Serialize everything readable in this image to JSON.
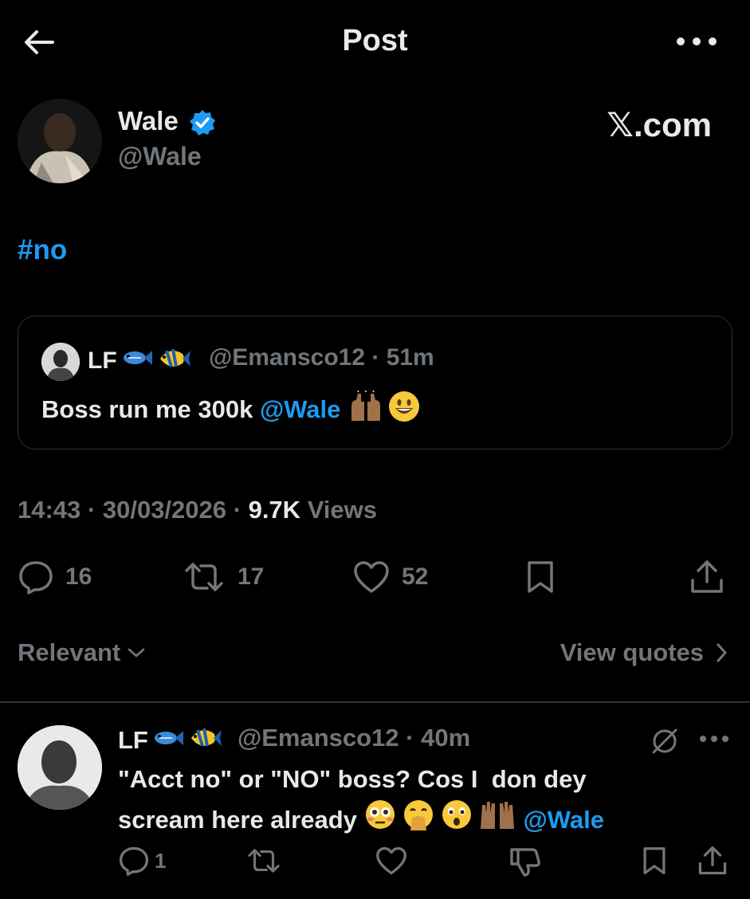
{
  "header": {
    "title": "Post"
  },
  "post": {
    "author_name": "Wale",
    "author_handle": "@Wale",
    "watermark": "𝕏.com",
    "text": "#no",
    "quote": {
      "name": "LF",
      "handle": "@Emansco12",
      "time": "51m",
      "text": "Boss run me 300k ",
      "mention": "@Wale"
    },
    "time": "14:43",
    "date": "30/03/2026",
    "views_count": "9.7K",
    "views_label": "Views",
    "replies": "16",
    "reposts": "17",
    "likes": "52"
  },
  "filters": {
    "sort_label": "Relevant",
    "view_quotes_label": "View quotes"
  },
  "reply": {
    "name": "LF",
    "handle": "@Emansco12",
    "time": "40m",
    "text_line1": "\"Acct no\" or \"NO\" boss? Cos I  don dey",
    "text_line2": "scream here already ",
    "mention": "@Wale",
    "replies": "1"
  },
  "colors": {
    "background": "#000000",
    "text": "#e7e9ea",
    "secondary": "#71767b",
    "accent": "#1d9bf0",
    "border": "#2f3336"
  }
}
